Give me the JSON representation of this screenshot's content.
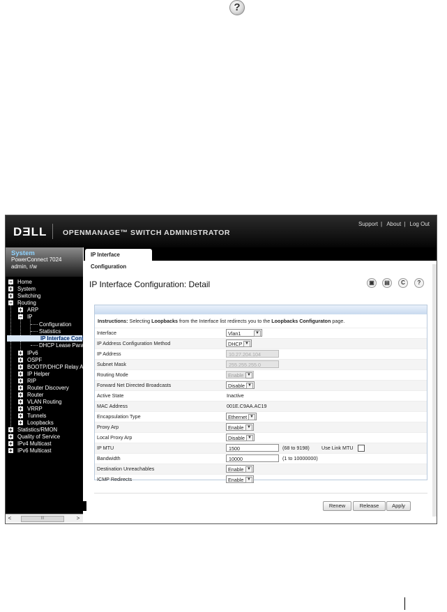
{
  "header": {
    "logo": "DƎLL",
    "brand": "OPENMANAGE™ SWITCH ADMINISTRATOR",
    "links": [
      "Support",
      "About",
      "Log Out"
    ],
    "separator": "|"
  },
  "system": {
    "title": "System",
    "model": "PowerConnect 7024",
    "user": "admin, r/w"
  },
  "nav": {
    "items": [
      {
        "label": "Home"
      },
      {
        "label": "System"
      },
      {
        "label": "Switching"
      },
      {
        "label": "Routing"
      },
      {
        "label": "ARP"
      },
      {
        "label": "IP"
      },
      {
        "label": "Configuration"
      },
      {
        "label": "Statistics"
      },
      {
        "label": "IP Interface Conf"
      },
      {
        "label": "DHCP Lease Paran"
      },
      {
        "label": "IPv6"
      },
      {
        "label": "OSPF"
      },
      {
        "label": "BOOTP/DHCP Relay Age"
      },
      {
        "label": "IP Helper"
      },
      {
        "label": "RIP"
      },
      {
        "label": "Router Discovery"
      },
      {
        "label": "Router"
      },
      {
        "label": "VLAN Routing"
      },
      {
        "label": "VRRP"
      },
      {
        "label": "Tunnels"
      },
      {
        "label": "Loopbacks"
      },
      {
        "label": "Statistics/RMON"
      },
      {
        "label": "Quality of Service"
      },
      {
        "label": "IPv4 Multicast"
      },
      {
        "label": "IPv6 Multicast"
      }
    ],
    "scroll_left": "<",
    "scroll_right": ">",
    "scroll_thumb": "III"
  },
  "tab": {
    "label": "IP Interface Configuration"
  },
  "page": {
    "title": "IP Interface Configuration: Detail"
  },
  "toolbar_icons": [
    "save-icon",
    "print-icon",
    "refresh-icon",
    "help-icon"
  ],
  "icons": {
    "help_glyph": "?",
    "refresh_glyph": "C",
    "save_glyph": "▣",
    "print_glyph": "▤",
    "arrow": "▼"
  },
  "instructions": {
    "prefix": "Instructions:",
    "t1": " Selecting ",
    "b1": "Loopbacks",
    "t2": " from the Interface list redirects you to the ",
    "b2": "Loopbacks Configuraton",
    "t3": " page."
  },
  "form": {
    "interface": {
      "label": "Interface",
      "value": "Vlan1"
    },
    "method": {
      "label": "IP Address Configuration Method",
      "value": "DHCP"
    },
    "ip": {
      "label": "IP Address",
      "value": "10.27.204.104"
    },
    "mask": {
      "label": "Subnet Mask",
      "value": "255.255.255.0"
    },
    "routing": {
      "label": "Routing Mode",
      "value": "Enable"
    },
    "fwd": {
      "label": "Forward Net Directed Broadcasts",
      "value": "Disable"
    },
    "active": {
      "label": "Active State",
      "value": "Inactive"
    },
    "mac": {
      "label": "MAC Address",
      "value": "001E.C9AA.AC19"
    },
    "encap": {
      "label": "Encapsulation Type",
      "value": "Ethernet"
    },
    "proxy": {
      "label": "Proxy Arp",
      "value": "Enable"
    },
    "lproxy": {
      "label": "Local Proxy Arp",
      "value": "Disable"
    },
    "mtu": {
      "label": "IP MTU",
      "value": "1500",
      "hint": "(68 to 9198)",
      "link_label": "Use Link MTU"
    },
    "bw": {
      "label": "Bandwidth",
      "value": "10000",
      "hint": "(1 to 10000000)"
    },
    "dest": {
      "label": "Destination Unreachables",
      "value": "Enable"
    },
    "icmp": {
      "label": "ICMP Redirects",
      "value": "Enable"
    }
  },
  "buttons": {
    "renew": "Renew",
    "release": "Release",
    "apply": "Apply"
  }
}
